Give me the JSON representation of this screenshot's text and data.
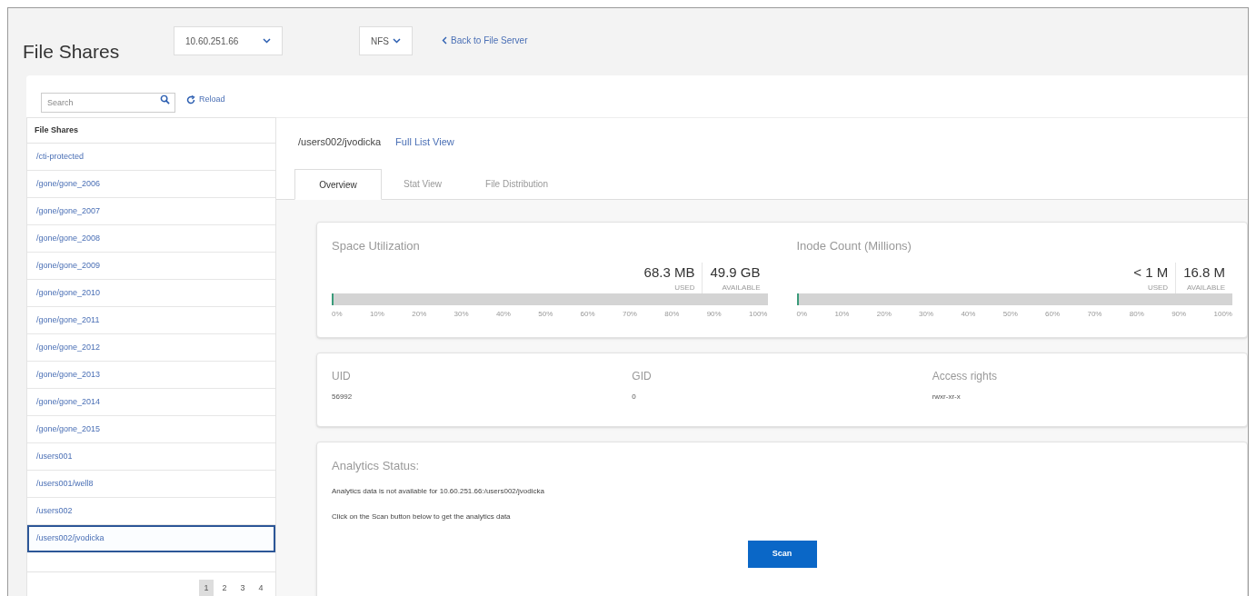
{
  "header": {
    "title": "File Shares",
    "server_select": {
      "value": "10.60.251.66"
    },
    "protocol_select": {
      "value": "NFS"
    },
    "back_link": "Back to File Server"
  },
  "sidebar": {
    "search": {
      "placeholder": "Search"
    },
    "reload": "Reload",
    "list_heading": "File Shares",
    "items": [
      {
        "label": "/cti-protected",
        "selected": false
      },
      {
        "label": "/gone/gone_2006",
        "selected": false
      },
      {
        "label": "/gone/gone_2007",
        "selected": false
      },
      {
        "label": "/gone/gone_2008",
        "selected": false
      },
      {
        "label": "/gone/gone_2009",
        "selected": false
      },
      {
        "label": "/gone/gone_2010",
        "selected": false
      },
      {
        "label": "/gone/gone_2011",
        "selected": false
      },
      {
        "label": "/gone/gone_2012",
        "selected": false
      },
      {
        "label": "/gone/gone_2013",
        "selected": false
      },
      {
        "label": "/gone/gone_2014",
        "selected": false
      },
      {
        "label": "/gone/gone_2015",
        "selected": false
      },
      {
        "label": "/users001",
        "selected": false
      },
      {
        "label": "/users001/well8",
        "selected": false
      },
      {
        "label": "/users002",
        "selected": false
      },
      {
        "label": "/users002/jvodicka",
        "selected": true
      }
    ],
    "pages": [
      {
        "label": "1",
        "selected": true
      },
      {
        "label": "2",
        "selected": false
      },
      {
        "label": "3",
        "selected": false
      },
      {
        "label": "4",
        "selected": false
      }
    ]
  },
  "detail": {
    "path": "/users002/jvodicka",
    "full_list_link": "Full List View",
    "tabs": [
      {
        "label": "Overview",
        "selected": true
      },
      {
        "label": "Stat View",
        "selected": false
      },
      {
        "label": "File Distribution",
        "selected": false
      }
    ],
    "meters": [
      {
        "title": "Space Utilization",
        "used": "68.3 MB",
        "used_label": "USED",
        "available": "49.9 GB",
        "available_label": "AVAILABLE",
        "level": 0.002,
        "ticks": [
          "0%",
          "10%",
          "20%",
          "30%",
          "40%",
          "50%",
          "60%",
          "70%",
          "80%",
          "90%",
          "100%"
        ]
      },
      {
        "title": "Inode Count (Millions)",
        "used": "< 1 M",
        "used_label": "USED",
        "available": "16.8 M",
        "available_label": "AVAILABLE",
        "level": 0.002,
        "ticks": [
          "0%",
          "10%",
          "20%",
          "30%",
          "40%",
          "50%",
          "60%",
          "70%",
          "80%",
          "90%",
          "100%"
        ]
      }
    ],
    "properties": [
      {
        "label": "UID",
        "value": "56992"
      },
      {
        "label": "GID",
        "value": "0"
      },
      {
        "label": "Access rights",
        "value": "rwxr-xr-x"
      }
    ],
    "analytics": {
      "title": "Analytics Status:",
      "message": "Analytics data is not available for 10.60.251.66:/users002/jvodicka",
      "hint": "Click on the Scan button below to get the analytics data",
      "scan_button": "Scan"
    }
  }
}
